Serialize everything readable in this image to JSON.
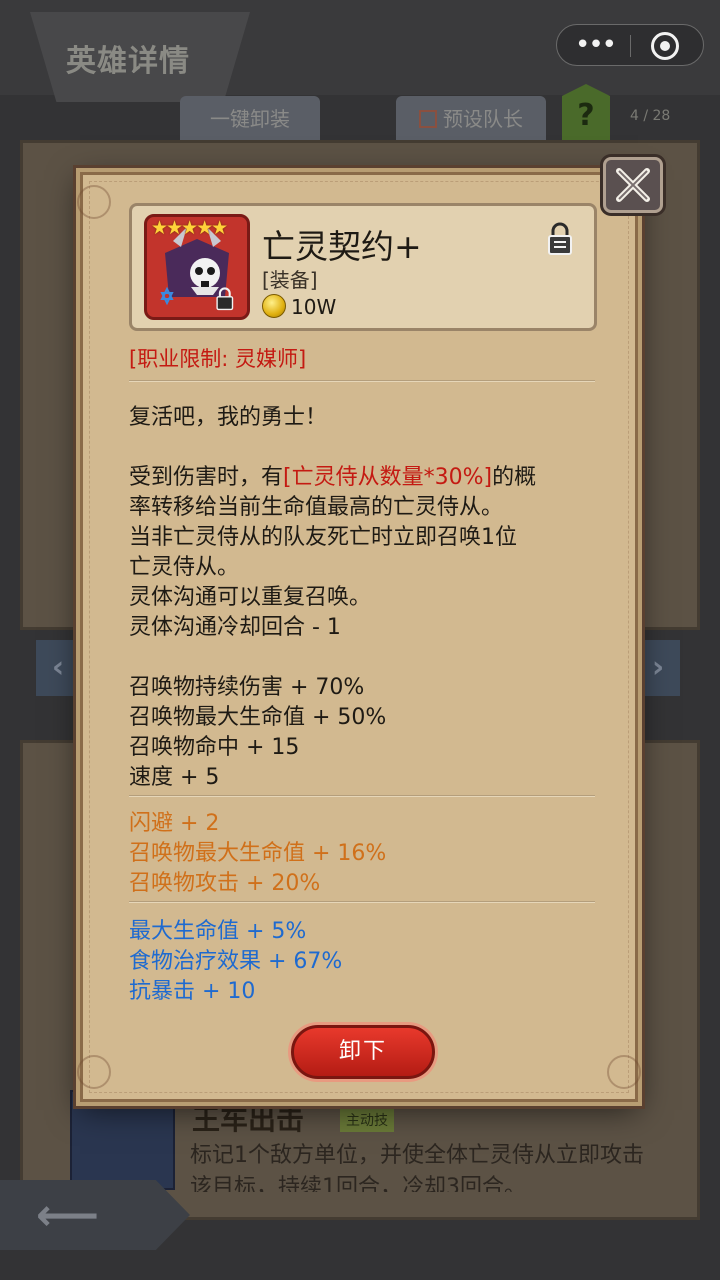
{
  "header": {
    "title": "英雄详情",
    "more_glyph": "•••"
  },
  "toolbar": {
    "unequip_all": "一键卸装",
    "preset_leader": "预设队长",
    "help": "?",
    "count": "4 / 28"
  },
  "background": {
    "skill_name": "王车出击",
    "skill_tag": "主动技",
    "skill_desc": "标记1个敌方单位，并使全体亡灵侍从立即攻击该目标，持续1回合，冷却3回合。"
  },
  "item": {
    "name": "亡灵契约+",
    "type": "[装备]",
    "price": "10W",
    "stars": "★★★★★",
    "class_limit": "[职业限制: 灵媒师]",
    "flavor": "复活吧，我的勇士！",
    "desc_lines": {
      "l1_pre": "受到伤害时，有",
      "l1_hl": "[亡灵侍从数量*30%]",
      "l1_post": "的概",
      "l2": "率转移给当前生命值最高的亡灵侍从。",
      "l3": "当非亡灵侍从的队友死亡时立即召唤1位",
      "l4": "亡灵侍从。",
      "l5": "灵体沟通可以重复召唤。",
      "l6": "灵体沟通冷却回合 - 1"
    },
    "base_stats": [
      "召唤物持续伤害 + 70%",
      "召唤物最大生命值 + 50%",
      "召唤物命中 + 15",
      "速度 + 5"
    ],
    "orange_stats": [
      "闪避 + 2",
      "召唤物最大生命值 + 16%",
      "召唤物攻击 + 20%"
    ],
    "blue_stats": [
      "最大生命值 + 5%",
      "食物治疗效果 + 67%",
      "抗暴击 + 10"
    ],
    "unequip_label": "卸下"
  },
  "colors": {
    "highlight_red": "#c41a12",
    "orange_stat": "#d0701a",
    "blue_stat": "#1e6ad0",
    "parchment": "#d2b990"
  }
}
